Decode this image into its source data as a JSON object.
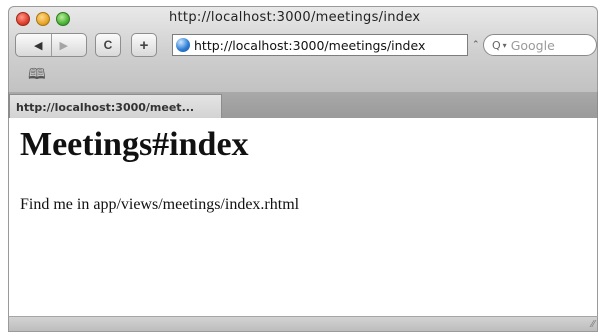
{
  "window": {
    "title": "http://localhost:3000/meetings/index"
  },
  "toolbar": {
    "back_glyph": "◀",
    "forward_glyph": "▶",
    "reload_glyph": "C",
    "add_glyph": "+",
    "address_value": "http://localhost:3000/meetings/index",
    "stepper_glyph": "⌃",
    "search_placeholder": "Google"
  },
  "bookmarks": {
    "icon": "book-icon",
    "glyph": "🕮"
  },
  "tabs": [
    {
      "label": "http://localhost:3000/meet..."
    }
  ],
  "page": {
    "heading": "Meetings#index",
    "text": "Find me in app/views/meetings/index.rhtml"
  },
  "colors": {
    "close": "#e0402f",
    "minimize": "#e9a72b",
    "maximize": "#4fb33a"
  }
}
